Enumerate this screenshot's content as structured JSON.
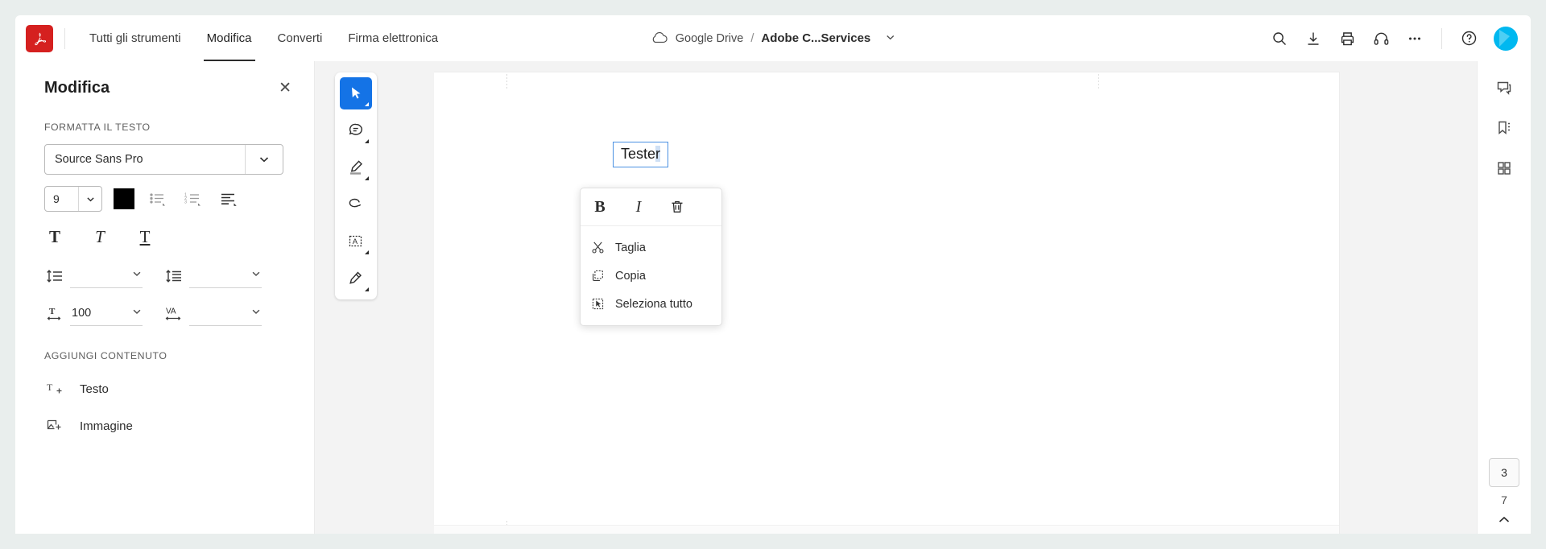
{
  "topbar": {
    "logo_icon": "adobe-acrobat-logo",
    "tabs": [
      {
        "label": "Tutti gli strumenti",
        "active": false
      },
      {
        "label": "Modifica",
        "active": true
      },
      {
        "label": "Converti",
        "active": false
      },
      {
        "label": "Firma elettronica",
        "active": false
      }
    ],
    "breadcrumb": {
      "cloud_icon": "cloud-icon",
      "source": "Google Drive",
      "separator": "/",
      "document": "Adobe C...Services",
      "chevron_icon": "chevron-down-icon"
    },
    "actions": [
      {
        "name": "search-icon",
        "label": "Cerca"
      },
      {
        "name": "download-icon",
        "label": "Scarica"
      },
      {
        "name": "print-icon",
        "label": "Stampa"
      },
      {
        "name": "headset-icon",
        "label": "Assistenza"
      },
      {
        "name": "more-icon",
        "label": "Altro"
      },
      {
        "name": "help-icon",
        "label": "Guida"
      }
    ],
    "avatar_label": "Account"
  },
  "left_panel": {
    "title": "Modifica",
    "close_label": "✕",
    "section_format": "FORMATTA IL TESTO",
    "font": {
      "value": "Source Sans Pro",
      "caret": "chevron-down-icon"
    },
    "size": {
      "value": "9",
      "caret": "chevron-down-icon"
    },
    "color_hex": "#000000",
    "list_icons": [
      {
        "name": "bulleted-list-icon"
      },
      {
        "name": "numbered-list-icon"
      },
      {
        "name": "align-icon"
      }
    ],
    "style_icons": [
      {
        "name": "bold-icon",
        "glyph": "T"
      },
      {
        "name": "italic-icon",
        "glyph": "T"
      },
      {
        "name": "underline-icon",
        "glyph": "T"
      }
    ],
    "spacing": {
      "line_spacing": {
        "icon": "line-spacing-icon",
        "value": ""
      },
      "paragraph_spacing": {
        "icon": "paragraph-spacing-icon",
        "value": ""
      },
      "horizontal_scale": {
        "icon": "horizontal-scale-icon",
        "value": "100"
      },
      "tracking": {
        "icon": "tracking-icon",
        "value": ""
      }
    },
    "section_add": "AGGIUNGI CONTENUTO",
    "add_items": [
      {
        "icon": "add-text-icon",
        "label": "Testo"
      },
      {
        "icon": "add-image-icon",
        "label": "Immagine"
      }
    ]
  },
  "tools": [
    {
      "name": "select-tool",
      "active": true
    },
    {
      "name": "comment-tool",
      "active": false
    },
    {
      "name": "highlight-tool",
      "active": false
    },
    {
      "name": "erase-tool",
      "active": false
    },
    {
      "name": "select-text-tool",
      "active": false
    },
    {
      "name": "fill-sign-tool",
      "active": false
    }
  ],
  "document": {
    "textbox_value": "Teste",
    "textbox_selection": "r"
  },
  "context_menu": {
    "top_actions": [
      {
        "name": "bold-button",
        "label": "B"
      },
      {
        "name": "italic-button",
        "label": "I"
      },
      {
        "name": "delete-button",
        "label": "🗑"
      }
    ],
    "items": [
      {
        "icon": "cut-icon",
        "label": "Taglia"
      },
      {
        "icon": "copy-icon",
        "label": "Copia"
      },
      {
        "icon": "select-all-icon",
        "label": "Seleziona tutto"
      }
    ]
  },
  "right_rail": {
    "icons": [
      {
        "name": "comments-icon",
        "label": "Commenti"
      },
      {
        "name": "bookmarks-icon",
        "label": "Segnalibri"
      },
      {
        "name": "thumbnails-icon",
        "label": "Miniature"
      }
    ],
    "page_current": "3",
    "page_total": "7",
    "page_up_icon": "chevron-up-icon"
  },
  "colors": {
    "accent": "#1473e6",
    "brand_red": "#d5201f",
    "avatar": "#00b8f0",
    "canvas_bg": "#f3f3f3",
    "app_bg": "#e9eeed"
  }
}
